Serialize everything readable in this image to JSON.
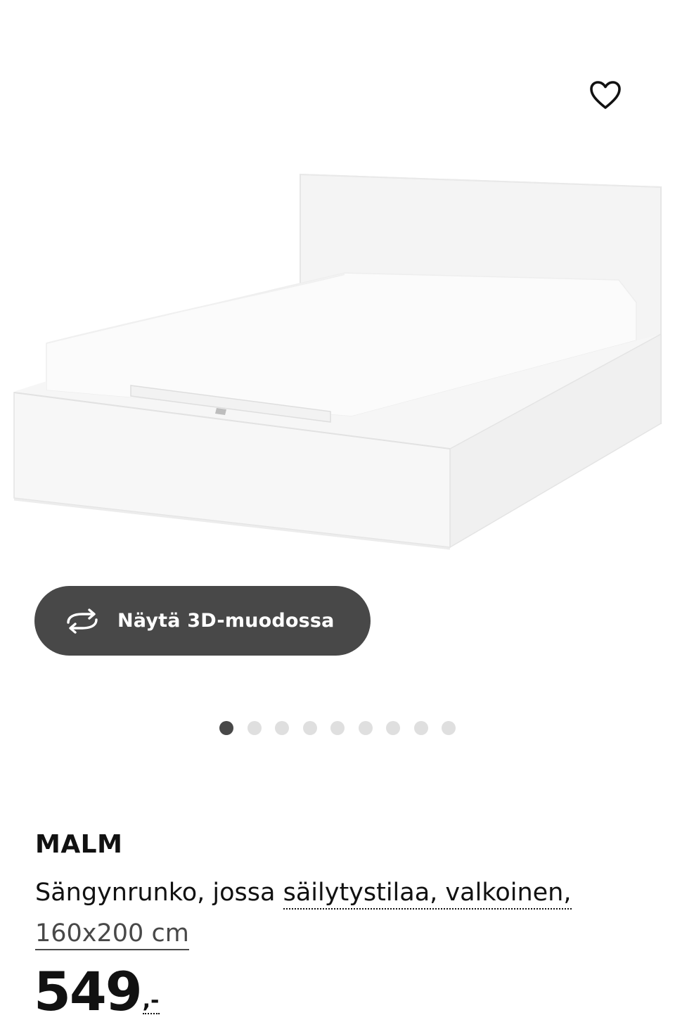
{
  "favorite": {
    "icon": "heart-outline-icon"
  },
  "image": {
    "alt": "",
    "colors": {
      "frame": "#f2f2f2",
      "mattress": "#fafafa",
      "shadow": "#e4e4e4"
    }
  },
  "view3d": {
    "label": "Näytä 3D-muodossa",
    "icon": "rotate-3d-icon",
    "background": "#484848"
  },
  "carousel": {
    "total": 9,
    "active_index": 0
  },
  "product": {
    "name": "MALM",
    "description_part1": "Sängynrunko, jossa ",
    "description_part2": "säilytystilaa, valkoinen,",
    "size": "160x200 cm"
  },
  "price": {
    "amount": "549",
    "suffix": ",-"
  }
}
